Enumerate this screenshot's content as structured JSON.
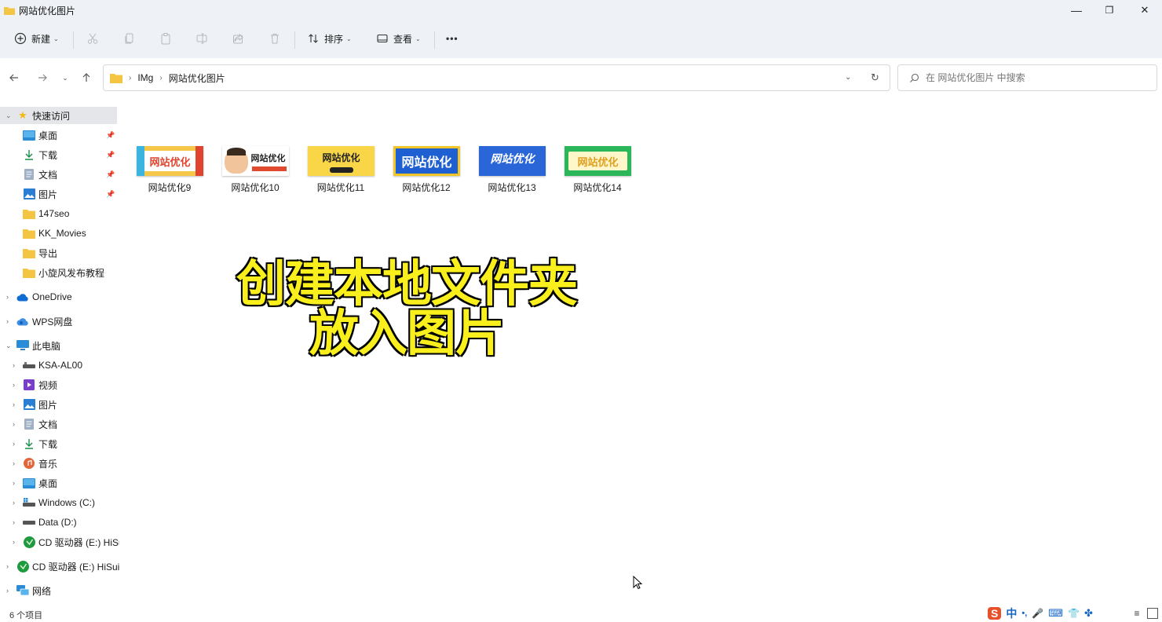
{
  "window": {
    "title": "网站优化图片",
    "controls": {
      "minimize": "—",
      "maximize": "❐",
      "close": "✕"
    }
  },
  "toolbar": {
    "new_label": "新建",
    "sort_label": "排序",
    "view_label": "查看",
    "more_label": "•••"
  },
  "address": {
    "crumbs": [
      "IMg",
      "网站优化图片"
    ],
    "search_placeholder": "在 网站优化图片 中搜索"
  },
  "sidebar": {
    "quick_access": "快速访问",
    "quick_items": [
      {
        "label": "桌面",
        "icon": "desktop-icon",
        "pinned": true
      },
      {
        "label": "下载",
        "icon": "download-icon",
        "pinned": true
      },
      {
        "label": "文档",
        "icon": "document-icon",
        "pinned": true
      },
      {
        "label": "图片",
        "icon": "picture-icon",
        "pinned": true
      },
      {
        "label": "147seo",
        "icon": "folder-icon",
        "pinned": false
      },
      {
        "label": "KK_Movies",
        "icon": "folder-icon",
        "pinned": false
      },
      {
        "label": "导出",
        "icon": "folder-icon",
        "pinned": false
      },
      {
        "label": "小旋风发布教程",
        "icon": "folder-icon",
        "pinned": false
      }
    ],
    "onedrive": "OneDrive",
    "wps": "WPS网盘",
    "this_pc": "此电脑",
    "pc_items": [
      {
        "label": "KSA-AL00",
        "icon": "device-icon"
      },
      {
        "label": "视频",
        "icon": "video-icon"
      },
      {
        "label": "图片",
        "icon": "picture-icon"
      },
      {
        "label": "文档",
        "icon": "document-icon"
      },
      {
        "label": "下载",
        "icon": "download-icon"
      },
      {
        "label": "音乐",
        "icon": "music-icon"
      },
      {
        "label": "桌面",
        "icon": "desktop-icon"
      },
      {
        "label": "Windows (C:)",
        "icon": "drive-c-icon"
      },
      {
        "label": "Data (D:)",
        "icon": "drive-d-icon"
      },
      {
        "label": "CD 驱动器 (E:) HiSu",
        "icon": "cd-drive-icon"
      }
    ],
    "cd_drive": "CD 驱动器 (E:) HiSui",
    "network": "网络"
  },
  "files": [
    {
      "name": "网站优化9",
      "thumb_text": "网站优化",
      "thumb_bg": "#f6c84a",
      "thumb_fg": "#e0442e"
    },
    {
      "name": "网站优化10",
      "thumb_text": "网站优化",
      "thumb_bg": "#ffffff",
      "thumb_fg": "#222222"
    },
    {
      "name": "网站优化11",
      "thumb_text": "网站优化",
      "thumb_bg": "#f9d648",
      "thumb_fg": "#222222"
    },
    {
      "name": "网站优化12",
      "thumb_text": "网站优化",
      "thumb_bg": "#1e5fd1",
      "thumb_fg": "#ffffff"
    },
    {
      "name": "网站优化13",
      "thumb_text": "网站优化",
      "thumb_bg": "#2a66d8",
      "thumb_fg": "#ffffff"
    },
    {
      "name": "网站优化14",
      "thumb_text": "网站优化",
      "thumb_bg": "#2bb65a",
      "thumb_fg": "#f6d331"
    }
  ],
  "overlay": {
    "line1": "创建本地文件夹",
    "line2": "放入图片"
  },
  "status": {
    "item_count": "6 个项目",
    "ime": [
      "S",
      "中",
      "•,",
      "🎤",
      "⌨",
      "👕",
      "✤"
    ]
  },
  "colors": {
    "chrome_bg": "#eef2f6",
    "selection_bg": "#e4e6e9",
    "folder_yellow": "#f4c542",
    "overlay_text": "#f8ef1d"
  }
}
